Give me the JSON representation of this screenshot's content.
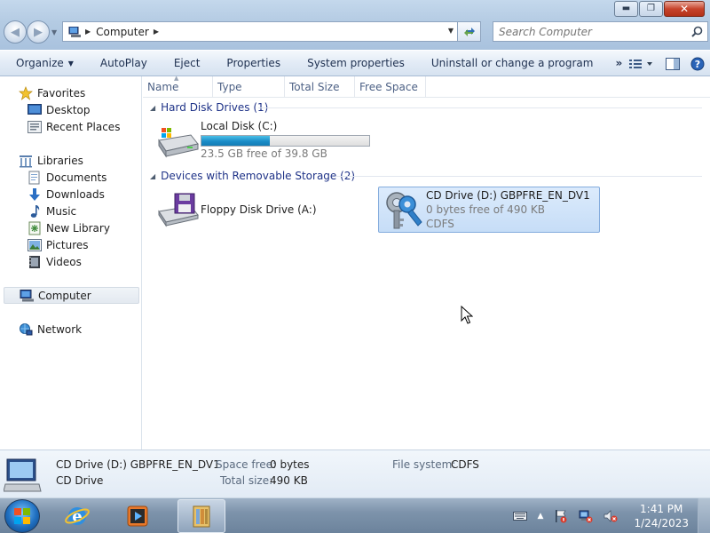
{
  "window": {
    "minimize_glyph": "▬",
    "maximize_glyph": "❐",
    "close_glyph": "✕"
  },
  "address": {
    "breadcrumb": "Computer",
    "search_placeholder": "Search Computer"
  },
  "toolbar": {
    "organize": "Organize",
    "autoplay": "AutoPlay",
    "eject": "Eject",
    "properties": "Properties",
    "system_properties": "System properties",
    "uninstall": "Uninstall or change a program",
    "more": "»"
  },
  "sidebar": {
    "favorites": {
      "label": "Favorites",
      "items": [
        {
          "label": "Desktop",
          "icon": "desktop-icon"
        },
        {
          "label": "Recent Places",
          "icon": "recent-places-icon"
        }
      ]
    },
    "libraries": {
      "label": "Libraries",
      "items": [
        {
          "label": "Documents",
          "icon": "documents-icon"
        },
        {
          "label": "Downloads",
          "icon": "downloads-icon"
        },
        {
          "label": "Music",
          "icon": "music-icon"
        },
        {
          "label": "New Library",
          "icon": "library-icon"
        },
        {
          "label": "Pictures",
          "icon": "pictures-icon"
        },
        {
          "label": "Videos",
          "icon": "videos-icon"
        }
      ]
    },
    "computer": "Computer",
    "network": "Network"
  },
  "columns": [
    "Name",
    "Type",
    "Total Size",
    "Free Space"
  ],
  "groups": {
    "hard_disks": {
      "title": "Hard Disk Drives (1)",
      "drives": [
        {
          "name": "Local Disk (C:)",
          "free_text": "23.5 GB free of 39.8 GB",
          "used_fraction": 0.41,
          "icon": "hard-disk-icon"
        }
      ]
    },
    "removable": {
      "title": "Devices with Removable Storage (2)",
      "drives": [
        {
          "name": "Floppy Disk Drive (A:)",
          "icon": "floppy-drive-icon"
        },
        {
          "name": "CD Drive (D:) GBPFRE_EN_DV1",
          "free_text": "0 bytes free of 490 KB",
          "fs": "CDFS",
          "icon": "cd-drive-keys-icon"
        }
      ]
    }
  },
  "details": {
    "name": "CD Drive (D:) GBPFRE_EN_DV1",
    "type": "CD Drive",
    "space_free_label": "Space free:",
    "space_free_value": "0 bytes",
    "total_size_label": "Total size:",
    "total_size_value": "490 KB",
    "file_system_label": "File system:",
    "file_system_value": "CDFS"
  },
  "taskbar": {
    "apps": [
      "internet-explorer-icon",
      "media-player-icon",
      "windows-explorer-icon"
    ],
    "time": "1:41 PM",
    "date": "1/24/2023",
    "tray_arrow": "▲"
  },
  "colors": {
    "accent": "#1e3287",
    "capacity_fill": "#1b8cc7",
    "selection": "#c6ddf7"
  }
}
